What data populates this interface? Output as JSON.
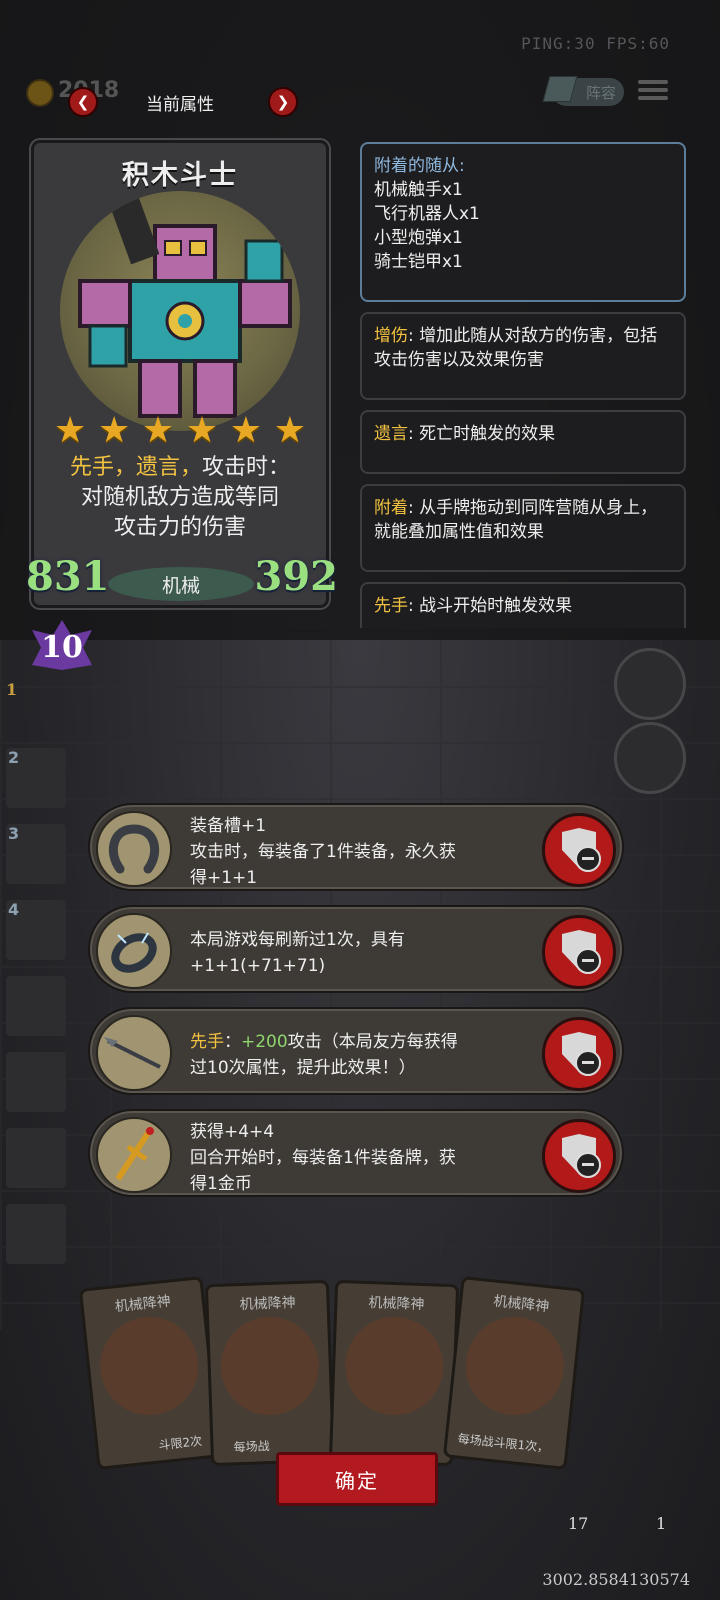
{
  "status": {
    "ping_fps": "PING:30  FPS:60",
    "coin_value": "2018"
  },
  "header": {
    "title": "当前属性",
    "lineup_label": "阵容"
  },
  "card": {
    "name": "积木斗士",
    "stars": [
      "★",
      "★",
      "★",
      "★",
      "★",
      "★"
    ],
    "desc_keywords": "先手，遗言，",
    "desc_rest": "攻击时：",
    "desc_line2": "对随机敌方造成等同",
    "desc_line3": "攻击力的伤害",
    "attack": "831",
    "health": "392",
    "tribe": "机械",
    "level": "10"
  },
  "attached": {
    "title": "附着的随从:",
    "items": [
      "机械触手x1",
      "飞行机器人x1",
      "小型炮弹x1",
      "骑士铠甲x1"
    ]
  },
  "glossary": [
    {
      "term": "增伤",
      "text": ": 增加此随从对敌方的伤害，包括攻击伤害以及效果伤害"
    },
    {
      "term": "遗言",
      "text": ": 死亡时触发的效果"
    },
    {
      "term": "附着",
      "text": ": 从手牌拖动到同阵营随从身上，就能叠加属性值和效果"
    },
    {
      "term": "先手",
      "text": ": 战斗开始时触发效果"
    }
  ],
  "slots": [
    "1",
    "2",
    "3",
    "4"
  ],
  "equipment": [
    {
      "icon": "horseshoe-icon",
      "line1": "装备槽+1",
      "line2": "攻击时，每装备了1件装备，永久获",
      "line3": "得+1+1"
    },
    {
      "icon": "bracelet-icon",
      "line1": "本局游戏每刷新过1次，具有",
      "line2": "+1+1(+71+71)",
      "line3": ""
    },
    {
      "icon": "spear-icon",
      "line1_kw": "先手",
      "line1_sep": "：",
      "line1_val": "+200",
      "line1_rest": "攻击（本局友方每获得",
      "line2": "过10次属性，提升此效果！）",
      "line3": ""
    },
    {
      "icon": "sword-icon",
      "line1": "获得+4+4",
      "line2": "回合开始时，每装备1件装备牌，获",
      "line3": "得1金币"
    }
  ],
  "hand_cards": [
    "机械降神",
    "机械降神",
    "机械降神",
    "机械降神"
  ],
  "hand_card_snippets": [
    "斗限2次",
    "每场战",
    "每场战斗限1次，"
  ],
  "confirm_label": "确定",
  "bottom_counts": {
    "left": "17",
    "right": "1"
  },
  "coords": "3002.8584130574"
}
